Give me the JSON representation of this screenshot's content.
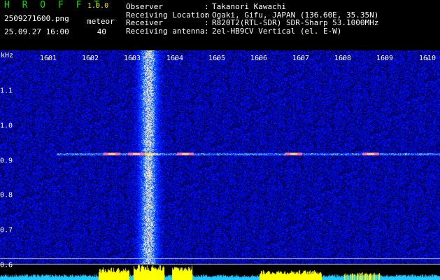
{
  "app": {
    "name": "H R O F F T",
    "version": "1.0.0"
  },
  "file": {
    "name": "2509271600.png",
    "datetime": "25.09.27 16:00"
  },
  "meteor": {
    "label": "meteor",
    "count": "40"
  },
  "info": {
    "labels": [
      "Observer",
      "Receiving Location",
      "Receiver",
      "Receiving antenna"
    ],
    "colons": [
      ":",
      ":",
      ":",
      ":"
    ],
    "values": [
      "Takanori Kawachi",
      "Ogaki, Gifu, JAPAN (136.60E, 35.35N)",
      "R820T2(RTL-SDR) SDR-Sharp 53.1000MHz",
      "2el-HB9CV Vertical (el. E-W)"
    ]
  },
  "axis": {
    "unit": "kHz",
    "x_ticks": [
      "1601",
      "1602",
      "1603",
      "1604",
      "1605",
      "1606",
      "1607",
      "1608",
      "1609",
      "1610"
    ],
    "y_ticks": [
      "1.1",
      "1.0",
      "0.9",
      "0.8",
      "0.7",
      "0.6"
    ]
  },
  "colors": {
    "background": "#000000",
    "noise": "#1a2dc8",
    "signal": "#ffff00",
    "title": "#00e000"
  }
}
